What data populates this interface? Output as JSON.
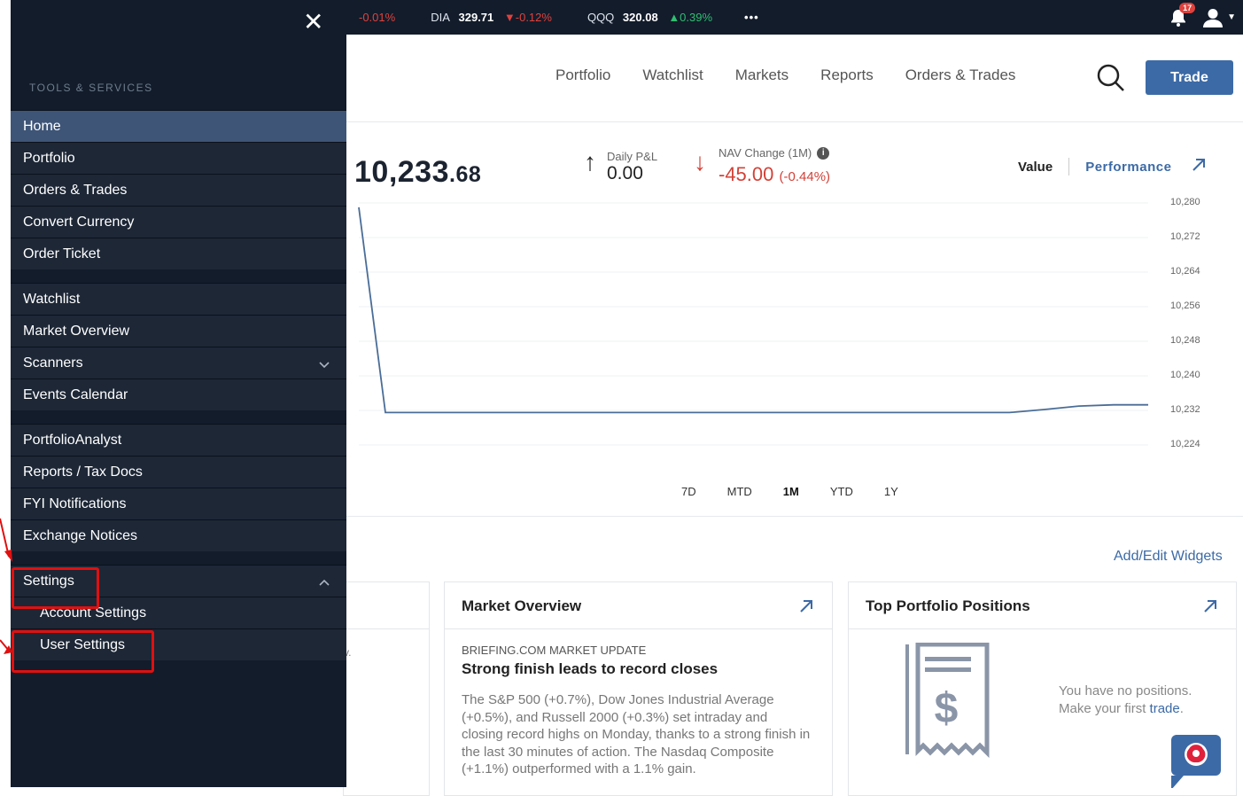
{
  "ticker": [
    {
      "symbol": "",
      "price": "",
      "change": "-0.01%",
      "dir": "down"
    },
    {
      "symbol": "DIA",
      "price": "329.71",
      "change": "▼-0.12%",
      "dir": "down"
    },
    {
      "symbol": "QQQ",
      "price": "320.08",
      "change": "▲0.39%",
      "dir": "up"
    }
  ],
  "ticker_more": "•••",
  "notifications_count": "17",
  "nav": {
    "links": [
      "Portfolio",
      "Watchlist",
      "Markets",
      "Reports",
      "Orders & Trades"
    ],
    "trade_button": "Trade"
  },
  "summary": {
    "nav_value_main": "10,233",
    "nav_value_dec": ".68",
    "daily_pnl_label": "Daily P&L",
    "daily_pnl_value": "0.00",
    "nav_change_label": "NAV Change (1M)",
    "nav_change_value": "-45.00",
    "nav_change_pct": "(-0.44%)",
    "toggle_value": "Value",
    "toggle_performance": "Performance"
  },
  "chart_data": {
    "type": "line",
    "title": "",
    "xlabel": "",
    "ylabel": "",
    "y_ticks": [
      "10,280",
      "10,272",
      "10,264",
      "10,256",
      "10,248",
      "10,240",
      "10,232",
      "10,224"
    ],
    "ylim": [
      10224,
      10280
    ],
    "series": [
      {
        "values": [
          10279,
          10231.5,
          10231.5,
          10231.5,
          10231.5,
          10231.5,
          10231.5,
          10231.5,
          10231.5,
          10231.5,
          10231.5,
          10231.5,
          10231.5,
          10231.5,
          10231.5,
          10231.5,
          10231.5,
          10231.5,
          10231.5,
          10231.5,
          10232.2,
          10233.0,
          10233.3,
          10233.3
        ]
      }
    ],
    "grid": true
  },
  "ranges": [
    "7D",
    "MTD",
    "1M",
    "YTD",
    "1Y"
  ],
  "active_range": "1M",
  "widgets_link": "Add/Edit Widgets",
  "market_overview": {
    "title": "Market Overview",
    "source": "BRIEFING.COM MARKET UPDATE",
    "headline": "Strong finish leads to record closes",
    "body": "The S&P 500 (+0.7%), Dow Jones Industrial Average (+0.5%), and Russell 2000 (+0.3%) set intraday and closing record highs on Monday, thanks to a strong finish in the last 30 minutes of action. The Nasdaq Composite (+1.1%) outperformed with a 1.1% gain."
  },
  "top_positions": {
    "title": "Top Portfolio Positions",
    "empty_line1": "You have no positions.",
    "empty_line2": "Make your first",
    "empty_link": "trade",
    "empty_end": "."
  },
  "drawer": {
    "section_label": "TOOLS & SERVICES",
    "groups": [
      [
        "Home",
        "Portfolio",
        "Orders & Trades",
        "Convert Currency",
        "Order Ticket"
      ],
      [
        "Watchlist",
        "Market Overview",
        "Scanners",
        "Events Calendar"
      ],
      [
        "PortfolioAnalyst",
        "Reports / Tax Docs",
        "FYI Notifications",
        "Exchange Notices"
      ],
      [
        "Settings"
      ]
    ],
    "settings_sub": [
      "Account Settings",
      "User Settings"
    ]
  },
  "partial_card_fragment": "v."
}
